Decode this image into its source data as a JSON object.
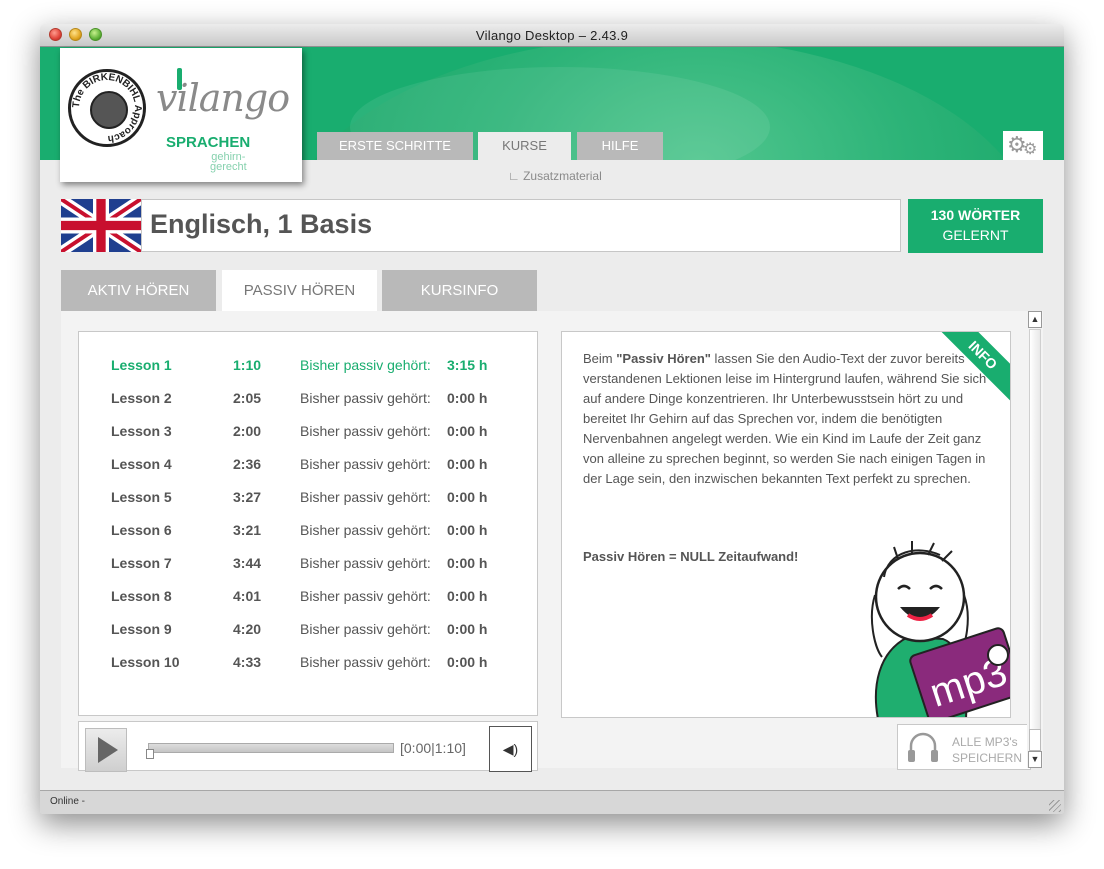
{
  "window": {
    "title": "Vilango Desktop – 2.43.9"
  },
  "logo": {
    "seal_text": "The BIRKENBIHL Approach",
    "brand": "vilango",
    "tagline": "SPRACHEN",
    "sub_tagline_1": "gehirn-",
    "sub_tagline_2": "gerecht"
  },
  "nav": {
    "tabs": [
      {
        "label": "ERSTE SCHRITTE",
        "active": false
      },
      {
        "label": "KURSE",
        "active": true
      },
      {
        "label": "HILFE",
        "active": false
      }
    ],
    "settings_icon": "gear-icon",
    "subnav": "∟  Zusatzmaterial"
  },
  "course": {
    "flag_icon": "uk-flag-icon",
    "title": "Englisch, 1 Basis",
    "words_line1": "130 WÖRTER",
    "words_line2": "GELERNT"
  },
  "content_tabs": [
    {
      "label": "AKTIV HÖREN",
      "active": false
    },
    {
      "label": "PASSIV HÖREN",
      "active": true
    },
    {
      "label": "KURSINFO",
      "active": false
    }
  ],
  "lessons": [
    {
      "name": "Lesson 1",
      "duration": "1:10",
      "label": "Bisher passiv gehört:",
      "heard": "3:15 h",
      "active": true
    },
    {
      "name": "Lesson 2",
      "duration": "2:05",
      "label": "Bisher passiv gehört:",
      "heard": "0:00 h",
      "active": false
    },
    {
      "name": "Lesson 3",
      "duration": "2:00",
      "label": "Bisher passiv gehört:",
      "heard": "0:00 h",
      "active": false
    },
    {
      "name": "Lesson 4",
      "duration": "2:36",
      "label": "Bisher passiv gehört:",
      "heard": "0:00 h",
      "active": false
    },
    {
      "name": "Lesson 5",
      "duration": "3:27",
      "label": "Bisher passiv gehört:",
      "heard": "0:00 h",
      "active": false
    },
    {
      "name": "Lesson 6",
      "duration": "3:21",
      "label": "Bisher passiv gehört:",
      "heard": "0:00 h",
      "active": false
    },
    {
      "name": "Lesson 7",
      "duration": "3:44",
      "label": "Bisher passiv gehört:",
      "heard": "0:00 h",
      "active": false
    },
    {
      "name": "Lesson 8",
      "duration": "4:01",
      "label": "Bisher passiv gehört:",
      "heard": "0:00 h",
      "active": false
    },
    {
      "name": "Lesson 9",
      "duration": "4:20",
      "label": "Bisher passiv gehört:",
      "heard": "0:00 h",
      "active": false
    },
    {
      "name": "Lesson 10",
      "duration": "4:33",
      "label": "Bisher passiv gehört:",
      "heard": "0:00 h",
      "active": false
    }
  ],
  "player": {
    "time": "[0:00|1:10]",
    "progress": 0,
    "play_icon": "play-icon",
    "volume_icon": "speaker-icon"
  },
  "info": {
    "ribbon": "INFO",
    "text_prefix": "Beim ",
    "text_bold": "\"Passiv Hören\"",
    "text_rest": " lassen Sie den Audio-Text der zuvor bereits verstandenen Lektionen leise im Hintergrund laufen, während Sie sich auf andere Dinge konzentrieren. Ihr Unterbewusstsein hört zu und bereitet Ihr Gehirn auf das Sprechen vor, indem die benötigten Nervenbahnen angelegt werden. Wie ein Kind im Laufe der Zeit ganz von alleine zu sprechen beginnt, so werden Sie nach einigen Tagen in der Lage sein, den inzwischen bekannten Text perfekt zu sprechen.",
    "footer": "Passiv Hören = NULL Zeitaufwand!",
    "illustration_label": "mp3"
  },
  "save_mp3": {
    "line1": "ALLE MP3's",
    "line2": "SPEICHERN",
    "icon": "headphones-icon"
  },
  "status": {
    "text": "Online -"
  },
  "colors": {
    "accent": "#19ad6f",
    "tab_inactive": "#b9b9b9",
    "mp3_purple": "#8a2a7c"
  }
}
